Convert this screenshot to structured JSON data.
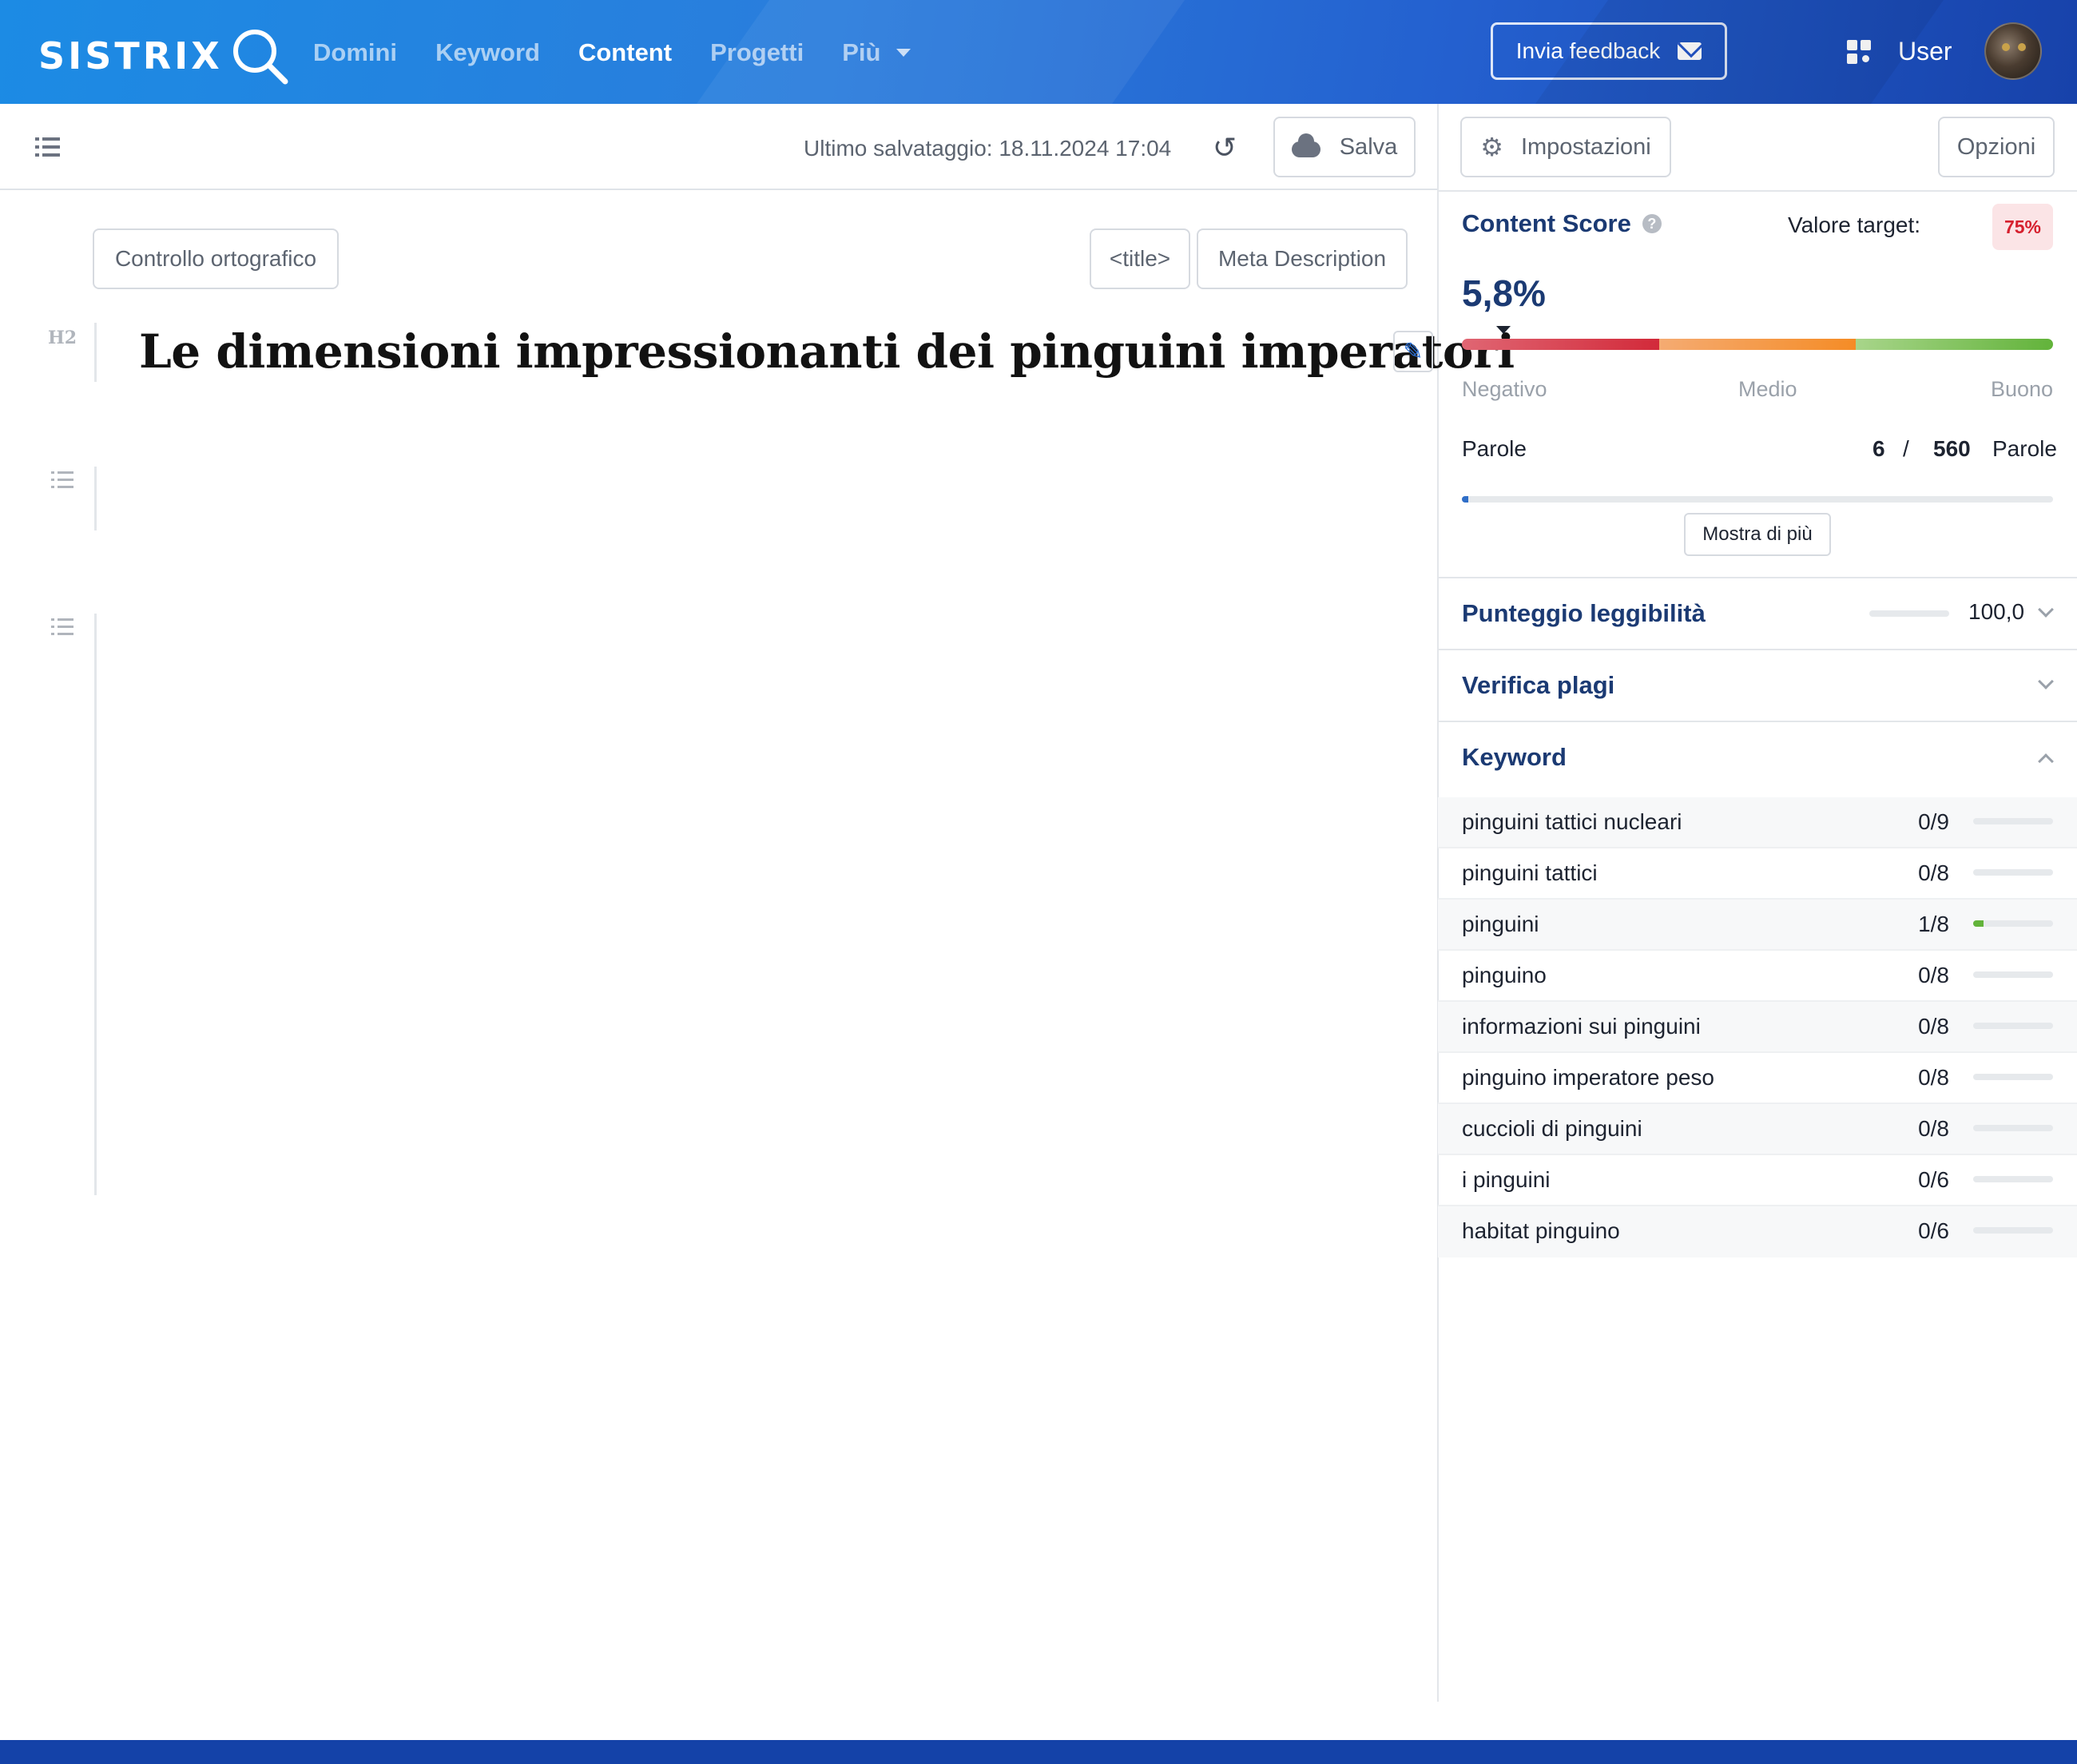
{
  "header": {
    "logo": "SISTRIX",
    "nav": [
      {
        "label": "Domini",
        "active": false
      },
      {
        "label": "Keyword",
        "active": false
      },
      {
        "label": "Content",
        "active": true
      },
      {
        "label": "Progetti",
        "active": false
      },
      {
        "label": "Più",
        "active": false
      }
    ],
    "feedback_label": "Invia feedback",
    "user_label": "User"
  },
  "toolbar": {
    "last_save": "Ultimo salvataggio: 18.11.2024 17:04",
    "save_label": "Salva"
  },
  "editor": {
    "spellcheck_label": "Controllo ortografico",
    "title_tag_label": "<title>",
    "meta_label": "Meta Description",
    "block_type": "H2",
    "heading": "Le dimensioni impressionanti dei pinguini imperatori"
  },
  "panel": {
    "settings_label": "Impostazioni",
    "options_label": "Opzioni",
    "content_score": {
      "title": "Content Score",
      "target_label": "Valore target:",
      "target_value": "75%",
      "value": "5,8%",
      "scale": [
        "Negativo",
        "Medio",
        "Buono"
      ]
    },
    "words": {
      "label": "Parole",
      "count": "6",
      "separator": "/",
      "target": "560",
      "unit": "Parole",
      "progress": 0.011
    },
    "show_more_label": "Mostra di più",
    "readability": {
      "title": "Punteggio leggibilità",
      "value": "100,0"
    },
    "plagiarism": {
      "title": "Verifica plagi"
    },
    "keyword_section": {
      "title": "Keyword"
    },
    "keywords": [
      {
        "name": "pinguini tattici nucleari",
        "count": "0/9",
        "progress": 0
      },
      {
        "name": "pinguini tattici",
        "count": "0/8",
        "progress": 0
      },
      {
        "name": "pinguini",
        "count": "1/8",
        "progress": 0.125
      },
      {
        "name": "pinguino",
        "count": "0/8",
        "progress": 0
      },
      {
        "name": "informazioni sui pinguini",
        "count": "0/8",
        "progress": 0
      },
      {
        "name": "pinguino imperatore peso",
        "count": "0/8",
        "progress": 0
      },
      {
        "name": "cuccioli di pinguini",
        "count": "0/8",
        "progress": 0
      },
      {
        "name": "i pinguini",
        "count": "0/6",
        "progress": 0
      },
      {
        "name": "habitat pinguino",
        "count": "0/6",
        "progress": 0
      }
    ]
  },
  "colors": {
    "brand_blue": "#1c8be4",
    "heading_blue": "#1b3a73",
    "negative": "#d22a3a",
    "medium": "#f58c26",
    "good": "#62b33a"
  }
}
